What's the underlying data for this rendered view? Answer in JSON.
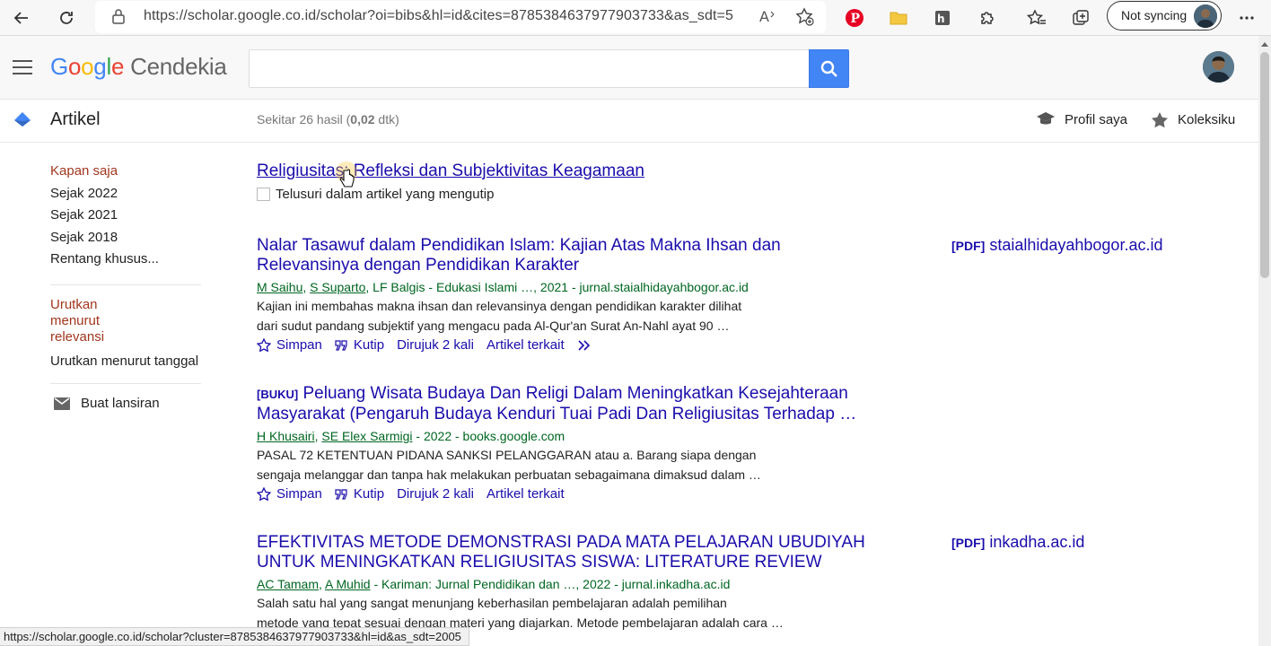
{
  "browser": {
    "url": "https://scholar.google.co.id/scholar?oi=bibs&hl=id&cites=8785384637977903733&as_sdt=5",
    "sync_label": "Not syncing"
  },
  "header": {
    "logo_google": [
      "G",
      "o",
      "o",
      "g",
      "l",
      "e"
    ],
    "logo_product": "Cendekia",
    "search_value": ""
  },
  "subheader": {
    "section": "Artikel",
    "result_prefix": "Sekitar 26 hasil (",
    "result_time": "0,02",
    "result_suffix": " dtk)",
    "profile": "Profil saya",
    "collection": "Koleksiku"
  },
  "sidebar": {
    "time_filters": [
      "Kapan saja",
      "Sejak 2022",
      "Sejak 2021",
      "Sejak 2018",
      "Rentang khusus..."
    ],
    "sort_relevance": "Urutkan menurut relevansi",
    "sort_date": "Urutkan menurut tanggal",
    "create_alert": "Buat lansiran"
  },
  "cited": {
    "title": "Religiusitas: Refleksi dan Subjektivitas Keagamaan",
    "search_within": "Telusuri dalam artikel yang mengutip"
  },
  "results": [
    {
      "tag": "",
      "title_line1": "Nalar Tasawuf dalam Pendidikan Islam: Kajian Atas Makna Ihsan dan",
      "title_line2": "Relevansinya dengan Pendidikan Karakter",
      "authors_linked": [
        "M Saihu",
        "S Suparto"
      ],
      "authors_rest": ", LF Balgis - Edukasi Islami …, 2021 - jurnal.staialhidayahbogor.ac.id",
      "snippet_line1": "Kajian ini membahas makna ihsan dan relevansinya dengan pendidikan karakter dilihat",
      "snippet_line2": "dari sudut pandang subjektif yang mengacu pada Al-Qur'an Surat An-Nahl ayat 90 …",
      "actions": [
        "Simpan",
        "Kutip",
        "Dirujuk 2 kali",
        "Artikel terkait"
      ],
      "side_tag": "[PDF]",
      "side_source": "staialhidayahbogor.ac.id"
    },
    {
      "tag": "[BUKU]",
      "title_line1": "Peluang Wisata Budaya Dan Religi Dalam Meningkatkan Kesejahteraan",
      "title_line2": "Masyarakat (Pengaruh Budaya Kenduri Tuai Padi Dan Religiusitas Terhadap …",
      "authors_linked": [
        "H Khusairi",
        "SE Elex Sarmigi"
      ],
      "authors_rest": " - 2022 - books.google.com",
      "snippet_line1": "PASAL 72 KETENTUAN PIDANA SANKSI PELANGGARAN atau a. Barang siapa dengan",
      "snippet_line2": "sengaja melanggar dan tanpa hak melakukan perbuatan sebagaimana dimaksud dalam …",
      "actions": [
        "Simpan",
        "Kutip",
        "Dirujuk 2 kali",
        "Artikel terkait"
      ],
      "side_tag": "",
      "side_source": ""
    },
    {
      "tag": "",
      "title_line1": "EFEKTIVITAS METODE DEMONSTRASI PADA MATA PELAJARAN UBUDIYAH",
      "title_line2": "UNTUK MENINGKATKAN RELIGIUSITAS SISWA: LITERATURE REVIEW",
      "authors_linked": [
        "AC Tamam",
        "A Muhid"
      ],
      "authors_rest": " - Kariman: Jurnal Pendidikan dan …, 2022 - jurnal.inkadha.ac.id",
      "snippet_line1": "Salah satu hal yang sangat menunjang keberhasilan pembelajaran adalah pemilihan",
      "snippet_line2": "metode yang tepat sesuai dengan materi yang diajarkan. Metode pembelajaran adalah cara …",
      "actions": [],
      "side_tag": "[PDF]",
      "side_source": "inkadha.ac.id"
    }
  ],
  "status_url": "https://scholar.google.co.id/scholar?cluster=8785384637977903733&hl=id&as_sdt=2005"
}
